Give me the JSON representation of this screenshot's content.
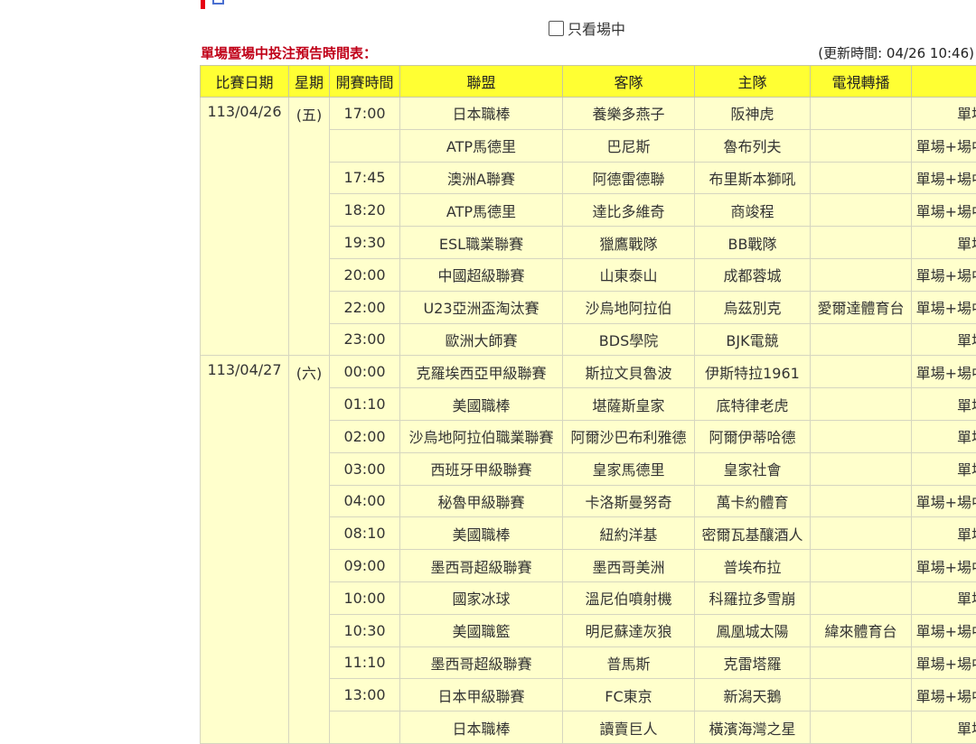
{
  "filter": {
    "only_live_label": "只看場中",
    "checked": false
  },
  "schedule": {
    "title": "單場暨場中投注預告時間表：",
    "update_time": "(更新時間: 04/26 10:46)",
    "headers": [
      "比賽日期",
      "星期",
      "開賽時間",
      "聯盟",
      "客隊",
      "主隊",
      "電視轉播",
      ""
    ],
    "days": [
      {
        "date": "113/04/26",
        "weekday": "(五)",
        "rows": [
          {
            "time": "17:00",
            "league": "日本職棒",
            "away": "養樂多燕子",
            "home": "阪神虎",
            "tv": "",
            "bet": "單場"
          },
          {
            "time": "",
            "league": "ATP馬德里",
            "away": "巴尼斯",
            "home": "魯布列夫",
            "tv": "",
            "bet": "單場+場中"
          },
          {
            "time": "17:45",
            "league": "澳洲A聯賽",
            "away": "阿德雷德聯",
            "home": "布里斯本獅吼",
            "tv": "",
            "bet": "單場+場中"
          },
          {
            "time": "18:20",
            "league": "ATP馬德里",
            "away": "達比多維奇",
            "home": "商竣程",
            "tv": "",
            "bet": "單場+場中"
          },
          {
            "time": "19:30",
            "league": "ESL職業聯賽",
            "away": "獵鷹戰隊",
            "home": "BB戰隊",
            "tv": "",
            "bet": "單場"
          },
          {
            "time": "20:00",
            "league": "中國超級聯賽",
            "away": "山東泰山",
            "home": "成都蓉城",
            "tv": "",
            "bet": "單場+場中"
          },
          {
            "time": "22:00",
            "league": "U23亞洲盃淘汰賽",
            "away": "沙烏地阿拉伯",
            "home": "烏茲別克",
            "tv": "愛爾達體育台",
            "bet": "單場+場中"
          },
          {
            "time": "23:00",
            "league": "歐洲大師賽",
            "away": "BDS學院",
            "home": "BJK電競",
            "tv": "",
            "bet": "單場"
          }
        ]
      },
      {
        "date": "113/04/27",
        "weekday": "(六)",
        "rows": [
          {
            "time": "00:00",
            "league": "克羅埃西亞甲級聯賽",
            "away": "斯拉文貝魯波",
            "home": "伊斯特拉1961",
            "tv": "",
            "bet": "單場+場中"
          },
          {
            "time": "01:10",
            "league": "美國職棒",
            "away": "堪薩斯皇家",
            "home": "底特律老虎",
            "tv": "",
            "bet": "單場"
          },
          {
            "time": "02:00",
            "league": "沙烏地阿拉伯職業聯賽",
            "away": "阿爾沙巴布利雅德",
            "home": "阿爾伊蒂哈德",
            "tv": "",
            "bet": "單場"
          },
          {
            "time": "03:00",
            "league": "西班牙甲級聯賽",
            "away": "皇家馬德里",
            "home": "皇家社會",
            "tv": "",
            "bet": "單場"
          },
          {
            "time": "04:00",
            "league": "秘魯甲級聯賽",
            "away": "卡洛斯曼努奇",
            "home": "萬卡約體育",
            "tv": "",
            "bet": "單場+場中"
          },
          {
            "time": "08:10",
            "league": "美國職棒",
            "away": "紐約洋基",
            "home": "密爾瓦基釀酒人",
            "tv": "",
            "bet": "單場"
          },
          {
            "time": "09:00",
            "league": "墨西哥超級聯賽",
            "away": "墨西哥美洲",
            "home": "普埃布拉",
            "tv": "",
            "bet": "單場+場中"
          },
          {
            "time": "10:00",
            "league": "國家冰球",
            "away": "溫尼伯噴射機",
            "home": "科羅拉多雪崩",
            "tv": "",
            "bet": "單場"
          },
          {
            "time": "10:30",
            "league": "美國職籃",
            "away": "明尼蘇達灰狼",
            "home": "鳳凰城太陽",
            "tv": "緯來體育台",
            "bet": "單場+場中"
          },
          {
            "time": "11:10",
            "league": "墨西哥超級聯賽",
            "away": "普馬斯",
            "home": "克雷塔羅",
            "tv": "",
            "bet": "單場+場中"
          },
          {
            "time": "13:00",
            "league": "日本甲級聯賽",
            "away": "FC東京",
            "home": "新潟天鵝",
            "tv": "",
            "bet": "單場+場中"
          },
          {
            "time": "",
            "league": "日本職棒",
            "away": "讀賣巨人",
            "home": "橫濱海灣之星",
            "tv": "",
            "bet": "單場"
          }
        ]
      }
    ]
  },
  "colors": {
    "header_bg": "#ffff33",
    "cell_bg": "#ffffcc",
    "title_red": "#c00018"
  }
}
